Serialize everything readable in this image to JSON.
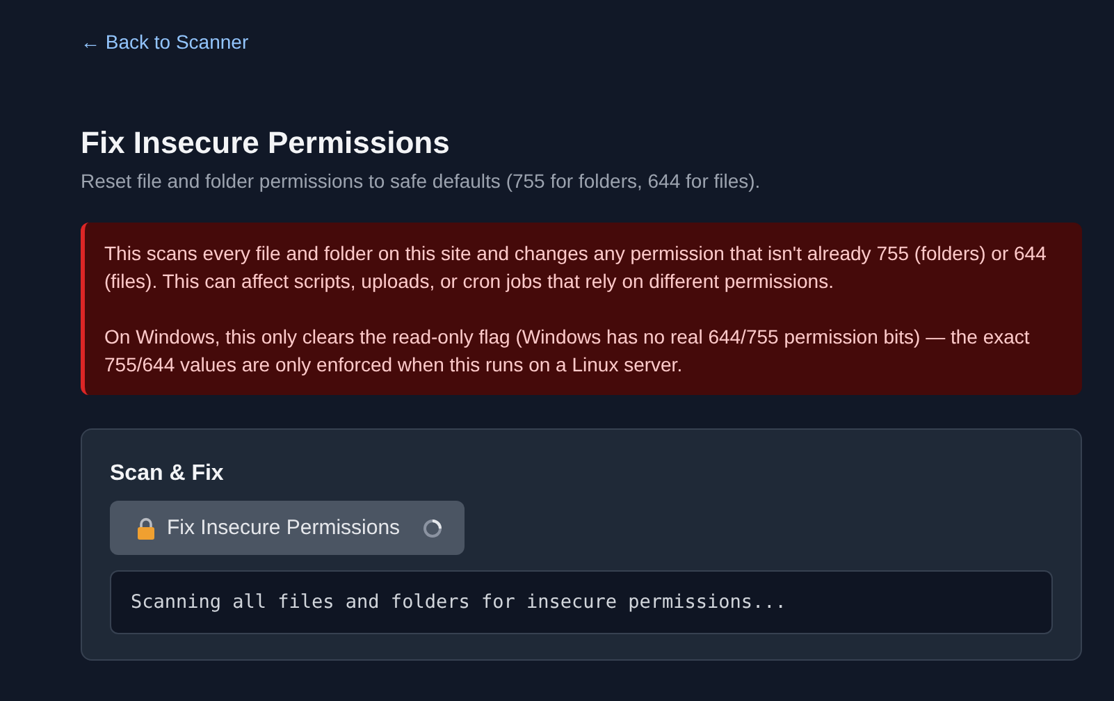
{
  "back_link": "← Back to Scanner",
  "title": "Fix Insecure Permissions",
  "subtitle": "Reset file and folder permissions to safe defaults (755 for folders, 644 for files).",
  "warning": {
    "paragraphs": [
      "This scans every file and folder on this site and changes any permission that isn't already 755 (folders) or 644 (files). This can affect scripts, uploads, or cron jobs that rely on different permissions.",
      "On Windows, this only clears the read-only flag (Windows has no real 644/755 permission bits) — the exact 755/644 values are only enforced when this runs on a Linux server."
    ]
  },
  "card": {
    "title": "Scan & Fix",
    "button": {
      "label": "Fix Insecure Permissions",
      "busy": true
    },
    "output": "Scanning all files and folders for insecure permissions..."
  }
}
